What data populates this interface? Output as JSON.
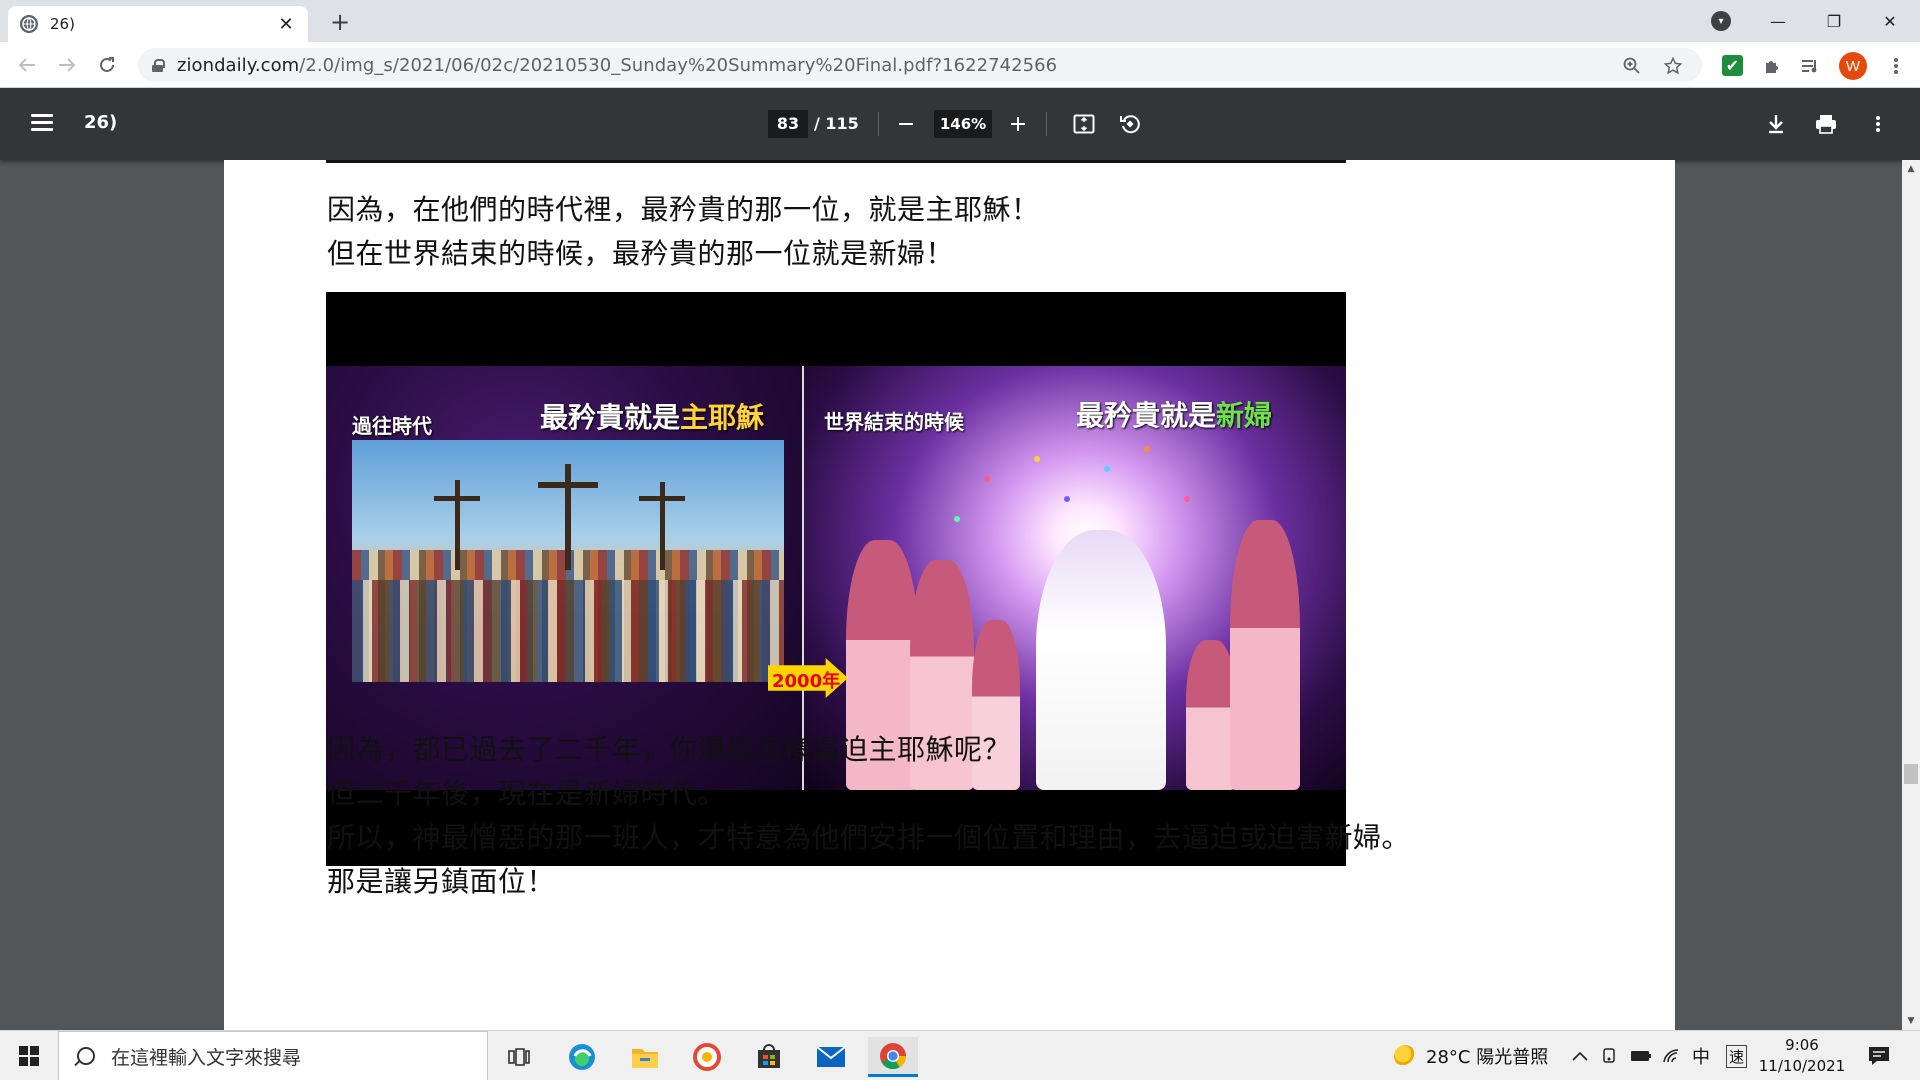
{
  "browser": {
    "tab": {
      "title": "26)",
      "close": "✕"
    },
    "new_tab": "+",
    "window_controls": {
      "profile_menu": "▾",
      "minimize": "—",
      "restore": "❐",
      "close": "✕"
    },
    "url_host": "ziondaily.com",
    "url_path": "/2.0/img_s/2021/06/02c/20210530_Sunday%20Summary%20Final.pdf?1622742566",
    "avatar_letter": "W",
    "accent": "#e8480c"
  },
  "pdf": {
    "title": "26)",
    "current_page": "83",
    "total_pages": "/ 115",
    "zoom": "146%"
  },
  "document": {
    "line1": "因為，在他們的時代裡，最矜貴的那一位，就是主耶穌！",
    "line2": "但在世界結束的時候，最矜貴的那一位就是新婦！",
    "figure": {
      "left_caption": "過往時代",
      "left_heading_a": "最矜貴就是",
      "left_heading_b": "主耶穌",
      "right_caption": "世界結束的時候",
      "right_heading_a": "最矜貴就是",
      "right_heading_b": "新婦",
      "badge": "2000年"
    },
    "line3": "因為，都已過去了二千年，你還能怎樣逼迫主耶穌呢？",
    "line4": "但二千年後，現在是新婦時代。",
    "line5": "所以，神最憎惡的那一班人，才特意為他們安排一個位置和理由，去逼迫或迫害新婦。",
    "line6": "那是讓另鎮面位！"
  },
  "taskbar": {
    "search_placeholder": "在這裡輸入文字來搜尋",
    "weather": "28°C 陽光普照",
    "ime_lang": "中",
    "ime_mode": "速",
    "time": "9:06",
    "date": "11/10/2021"
  }
}
